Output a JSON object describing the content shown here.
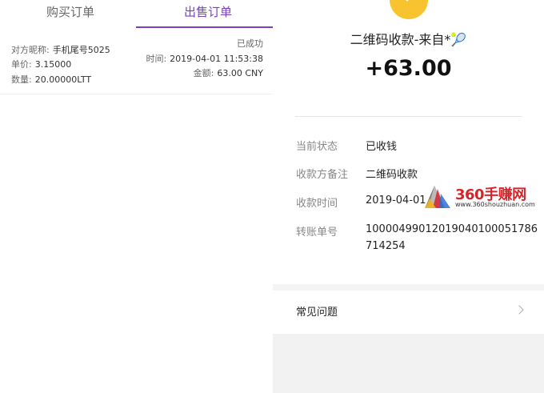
{
  "left": {
    "tabs": [
      "购买订单",
      "出售订单"
    ],
    "order": {
      "counterparty_label": "对方昵称:",
      "counterparty_value": "手机尾号5025",
      "price_label": "单价:",
      "price_value": "3.15000",
      "qty_label": "数量:",
      "qty_value": "20.00000LTT",
      "status": "已成功",
      "time_label": "时间:",
      "time_value": "2019-04-01 11:53:38",
      "amount_label": "金额:",
      "amount_value": "63.00 CNY"
    }
  },
  "right": {
    "title": "二维码收款-来自*🎾",
    "amount": "+63.00",
    "rows": [
      {
        "label": "当前状态",
        "value": "已收钱"
      },
      {
        "label": "收款方备注",
        "value": "二维码收款"
      },
      {
        "label": "收款时间",
        "value": "2019-04-01 1"
      },
      {
        "label": "转账单号",
        "value": "10000499012019040100051786 714254"
      }
    ],
    "txn_line1": "10000499012019040100051786",
    "txn_line2": "714254",
    "faq": "常见问题"
  },
  "watermark": {
    "brand": "360手赚网",
    "url": "www.360shouzhuan.com"
  },
  "colors": {
    "accent": "#7b3fc4",
    "coin": "#f7c42f",
    "watermark": "#d6252a"
  }
}
